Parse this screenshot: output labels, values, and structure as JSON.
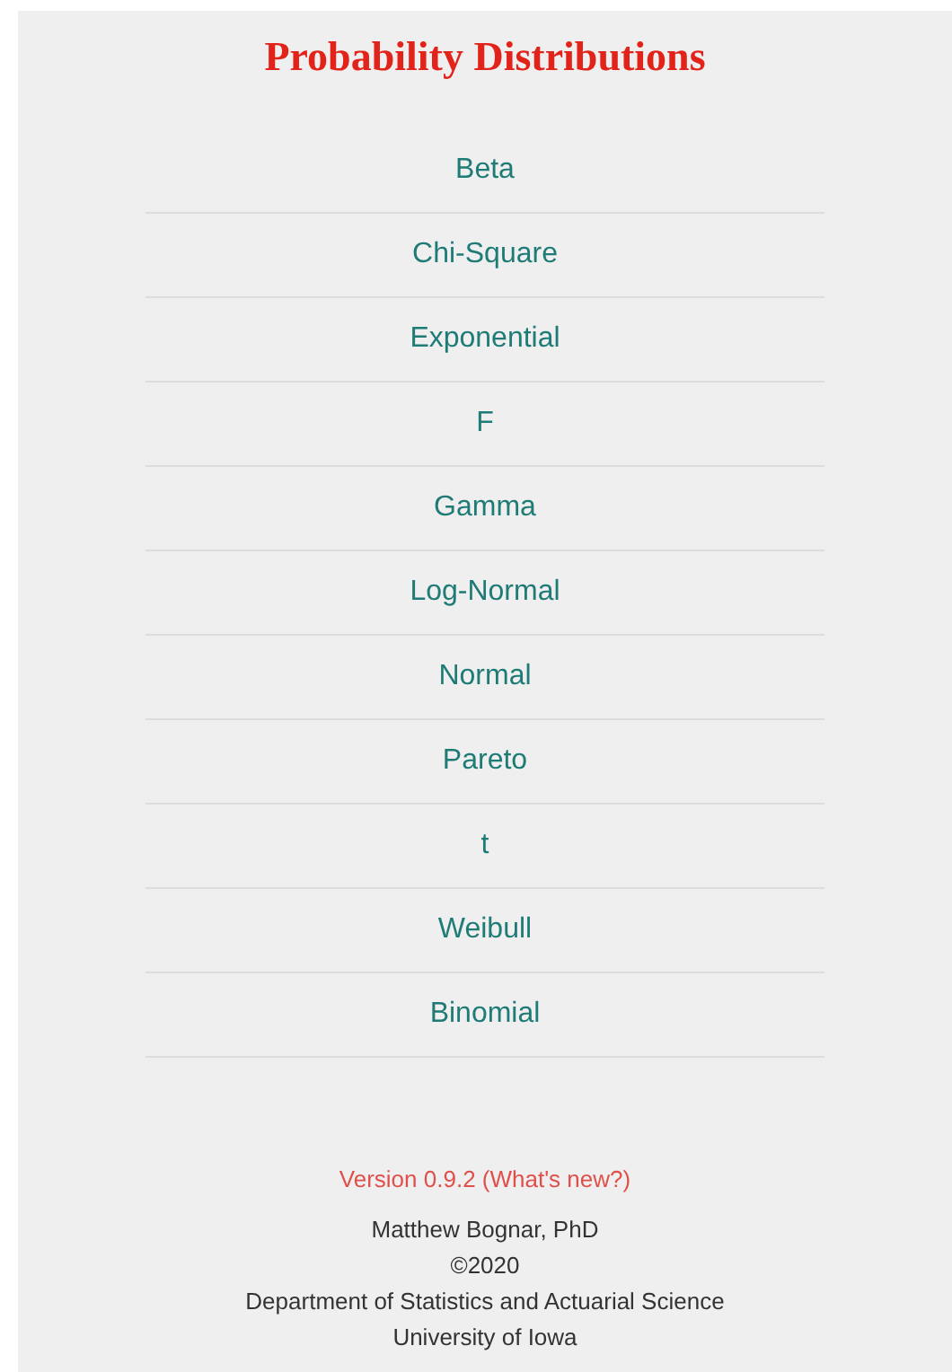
{
  "title": "Probability Distributions",
  "distributions": [
    "Beta",
    "Chi-Square",
    "Exponential",
    "F",
    "Gamma",
    "Log-Normal",
    "Normal",
    "Pareto",
    "t",
    "Weibull",
    "Binomial"
  ],
  "footer": {
    "version_link": "Version 0.9.2 (What's new?)",
    "lines": [
      "Matthew Bognar, PhD",
      "©2020",
      "Department of Statistics and Actuarial Science",
      "University of Iowa"
    ]
  }
}
